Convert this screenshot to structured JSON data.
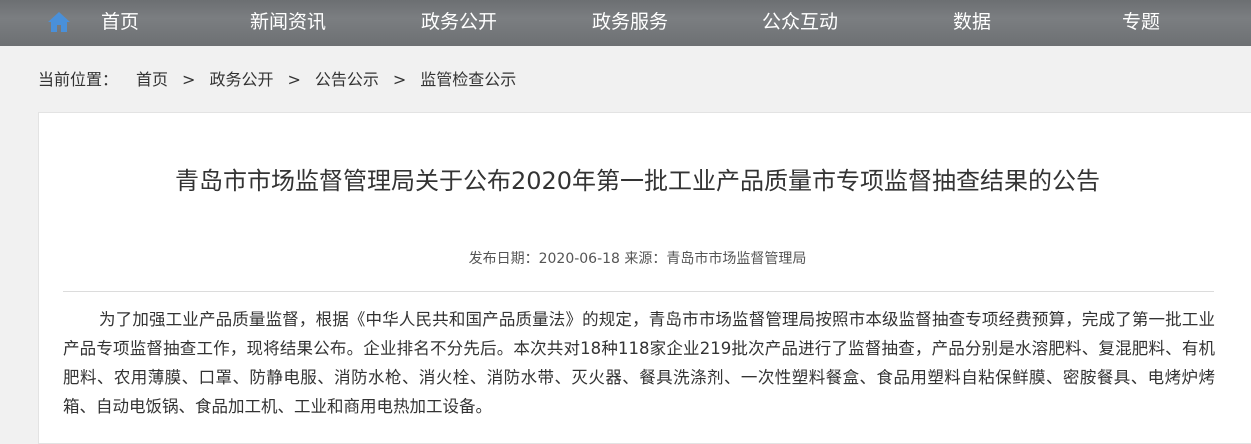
{
  "nav": {
    "items": [
      "首页",
      "新闻资讯",
      "政务公开",
      "政务服务",
      "公众互动",
      "数据",
      "专题"
    ]
  },
  "breadcrumb": {
    "label": "当前位置：",
    "items": [
      "首页",
      "政务公开",
      "公告公示",
      "监管检查公示"
    ],
    "separator": ">"
  },
  "article": {
    "title": "青岛市市场监督管理局关于公布2020年第一批工业产品质量市专项监督抽查结果的公告",
    "meta": "发布日期：2020-06-18 来源：青岛市市场监督管理局",
    "body": "为了加强工业产品质量监督，根据《中华人民共和国产品质量法》的规定，青岛市市场监督管理局按照市本级监督抽查专项经费预算，完成了第一批工业产品专项监督抽查工作，现将结果公布。企业排名不分先后。本次共对18种118家企业219批次产品进行了监督抽查，产品分别是水溶肥料、复混肥料、有机肥料、农用薄膜、口罩、防静电服、消防水枪、消火栓、消防水带、灭火器、餐具洗涤剂、一次性塑料餐盒、食品用塑料自粘保鲜膜、密胺餐具、电烤炉烤箱、自动电饭锅、食品加工机、工业和商用电热加工设备。"
  },
  "colors": {
    "nav_bg": "#75787b",
    "home_icon": "#4a90d9",
    "page_bg": "#f1f1f1"
  },
  "icons": {
    "home": "home-icon"
  }
}
